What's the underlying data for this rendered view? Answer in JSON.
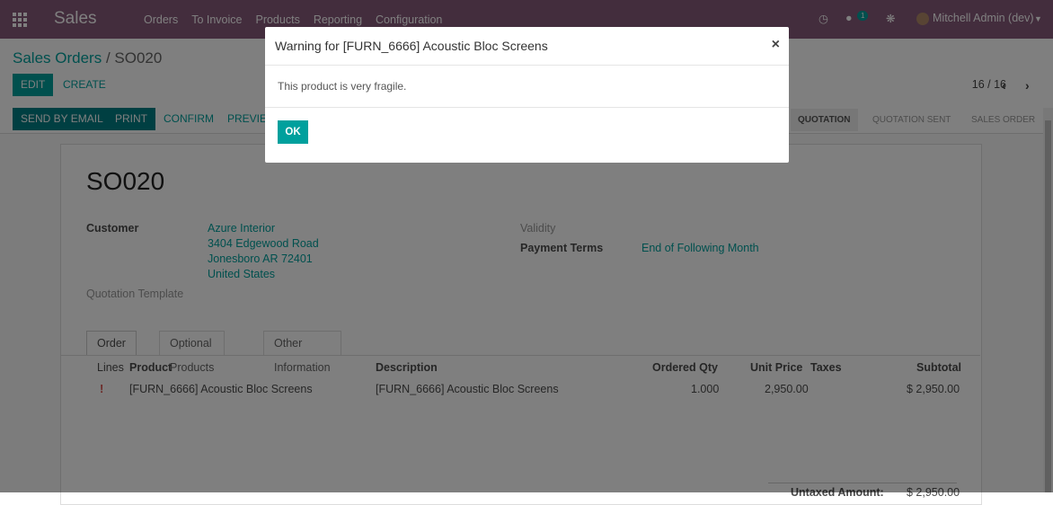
{
  "navbar": {
    "app_name": "Sales",
    "menu": [
      "Orders",
      "To Invoice",
      "Products",
      "Reporting",
      "Configuration"
    ],
    "messages_count": "1",
    "user": "Mitchell Admin (dev)",
    "icons": [
      "apps-icon",
      "clock-icon",
      "chat-icon",
      "bug-icon",
      "caret-down-icon"
    ]
  },
  "breadcrumb": {
    "parent": "Sales Orders",
    "separator": "/",
    "current": "SO020"
  },
  "buttons": {
    "edit": "EDIT",
    "create": "CREATE",
    "send_by_email": "SEND BY EMAIL",
    "print": "PRINT",
    "confirm": "CONFIRM",
    "preview": "PREVIEW"
  },
  "pager": {
    "value": "16 / 16"
  },
  "statusbar": [
    "QUOTATION",
    "QUOTATION SENT",
    "SALES ORDER"
  ],
  "form": {
    "title": "SO020",
    "customer_label": "Customer",
    "customer_name": "Azure Interior",
    "address_line1": "3404 Edgewood Road",
    "address_line2": "Jonesboro AR 72401",
    "address_line3": "United States",
    "quotation_template_label": "Quotation Template",
    "validity_label": "Validity",
    "payment_terms_label": "Payment Terms",
    "payment_terms_value": "End of Following Month"
  },
  "tabs": [
    "Order Lines",
    "Optional Products",
    "Other Information"
  ],
  "table": {
    "headers": [
      "Product",
      "Description",
      "Ordered Qty",
      "Unit Price",
      "Taxes",
      "Subtotal"
    ],
    "row": {
      "product": "[FURN_6666] Acoustic Bloc Screens",
      "description": "[FURN_6666] Acoustic Bloc Screens",
      "qty": "1.000",
      "unit_price": "2,950.00",
      "subtotal": "$ 2,950.00"
    },
    "untaxed_label": "Untaxed Amount:",
    "untaxed_value": "$ 2,950.00"
  },
  "modal": {
    "title": "Warning for [FURN_6666] Acoustic Bloc Screens",
    "close": "×",
    "message": "This product is very fragile.",
    "ok": "OK"
  }
}
